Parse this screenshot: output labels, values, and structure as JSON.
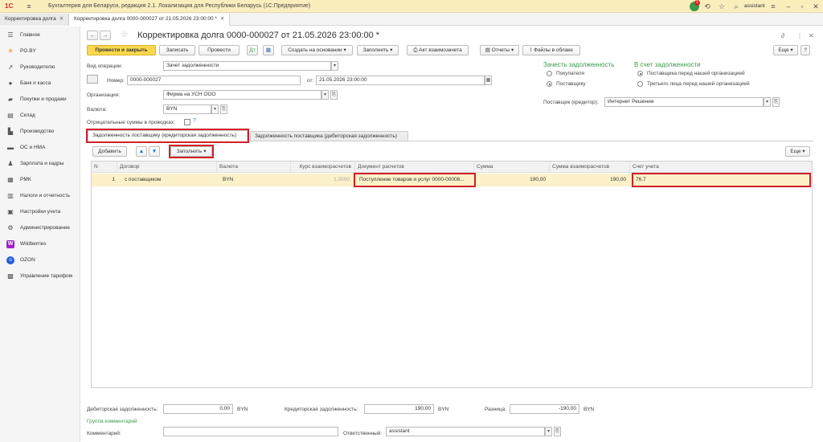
{
  "app": {
    "title": "Бухгалтерия для Беларуси, редакция 2.1. Локализация для Республики Беларусь   (1С:Предприятие)",
    "notifications_count": "1",
    "user": "assistant"
  },
  "window_tabs": [
    {
      "label": "Корректировка долга"
    },
    {
      "label": "Корректировка долга 0000-000027 от 21.05.2026 23:00:00 *"
    }
  ],
  "sidebar": {
    "items": [
      {
        "label": "Главное",
        "icon": "menu-icon"
      },
      {
        "label": "PO.BY",
        "icon": "poby-icon"
      },
      {
        "label": "Руководителю",
        "icon": "chart-icon"
      },
      {
        "label": "Банк и касса",
        "icon": "bank-icon"
      },
      {
        "label": "Покупки и продажи",
        "icon": "cart-icon"
      },
      {
        "label": "Склад",
        "icon": "warehouse-icon"
      },
      {
        "label": "Производство",
        "icon": "factory-icon"
      },
      {
        "label": "ОС и НМА",
        "icon": "car-icon"
      },
      {
        "label": "Зарплата и кадры",
        "icon": "people-icon"
      },
      {
        "label": "PMK",
        "icon": "pmk-icon"
      },
      {
        "label": "Налоги и отчетность",
        "icon": "tax-icon"
      },
      {
        "label": "Настройки учета",
        "icon": "settings-icon"
      },
      {
        "label": "Администрирование",
        "icon": "gear-icon"
      },
      {
        "label": "Wildberries",
        "icon": "wildberries-icon"
      },
      {
        "label": "OZON",
        "icon": "ozon-icon"
      },
      {
        "label": "Управление тарифом",
        "icon": "tariff-icon"
      }
    ]
  },
  "form": {
    "title": "Корректировка долга 0000-000027 от 21.05.2026 23:00:00 *",
    "toolbar": {
      "post_close": "Провести и закрыть",
      "save": "Записать",
      "post": "Провести",
      "create_based": "Создать на основании",
      "fill": "Заполнить",
      "act": "Акт взаимозачета",
      "reports": "Отчеты",
      "cloud_files": "Файлы в облаке",
      "more": "Еще"
    },
    "operation_label": "Вид операции:",
    "operation_value": "Зачет задолженности",
    "number_label": "Номер:",
    "number_value": "0000-000027",
    "date_label": "от:",
    "date_value": "21.05.2026 23:00:00",
    "org_label": "Организация:",
    "org_value": "Фирма на УСН ООО",
    "currency_label": "Валюта:",
    "currency_value": "BYN",
    "negative_label": "Отрицательные суммы в проводках:",
    "offset_title": "Зачесть задолженность",
    "offset_options": [
      "Покупателя",
      "Поставщику"
    ],
    "account_title": "В счет задолженности",
    "account_options": [
      "Поставщика перед нашей организацией",
      "Третьего лица перед нашей организацией"
    ],
    "supplier_label": "Поставщик (кредитор):",
    "supplier_value": "Интернет Решения"
  },
  "tabs": [
    {
      "label": "Задолженность поставщику (кредиторская задолженность)"
    },
    {
      "label": "Задолженность поставщика (дебиторская задолженность)"
    }
  ],
  "table_toolbar": {
    "add": "Добавить",
    "fill": "Заполнить",
    "more": "Еще"
  },
  "table": {
    "columns": [
      "N",
      "Договор",
      "Валюта",
      "Курс взаиморасчетов",
      "Документ расчетов",
      "Сумма",
      "Сумма взаиморасчетов",
      "Счет учета"
    ],
    "rows": [
      {
        "n": "1",
        "contract": "с поставщиком",
        "currency": "BYN",
        "rate": "1,0000",
        "document": "Поступление товаров и услуг 0000-00008...",
        "sum": "190,00",
        "settlement_sum": "190,00",
        "account": "76.7"
      }
    ]
  },
  "footer": {
    "debit_label": "Дебиторская задолженность:",
    "debit_value": "0,00",
    "debit_cur": "BYN",
    "credit_label": "Кредиторская задолженность:",
    "credit_value": "190,00",
    "credit_cur": "BYN",
    "diff_label": "Разница:",
    "diff_value": "-190,00",
    "diff_cur": "BYN",
    "comment_group": "Группа комментарий",
    "comment_label": "Комментарий:",
    "responsible_label": "Ответственный:",
    "responsible_value": "assistant"
  }
}
